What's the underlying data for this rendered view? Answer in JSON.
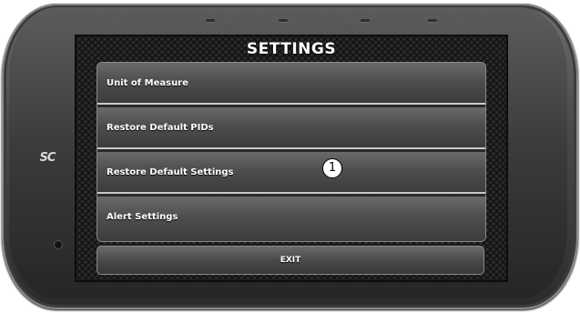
{
  "device": {
    "logo_text": "SC"
  },
  "screen": {
    "title": "SETTINGS",
    "menu": [
      {
        "label": "Unit of Measure"
      },
      {
        "label": "Restore Default PIDs"
      },
      {
        "label": "Restore Default Settings"
      },
      {
        "label": "Alert Settings"
      }
    ],
    "callout_number": "1",
    "exit_label": "EXIT"
  },
  "colors": {
    "screen_bg": "#151515",
    "button_gradient_top": "#6a6a6a",
    "separator": "#c9c9c9",
    "text": "#ffffff"
  }
}
